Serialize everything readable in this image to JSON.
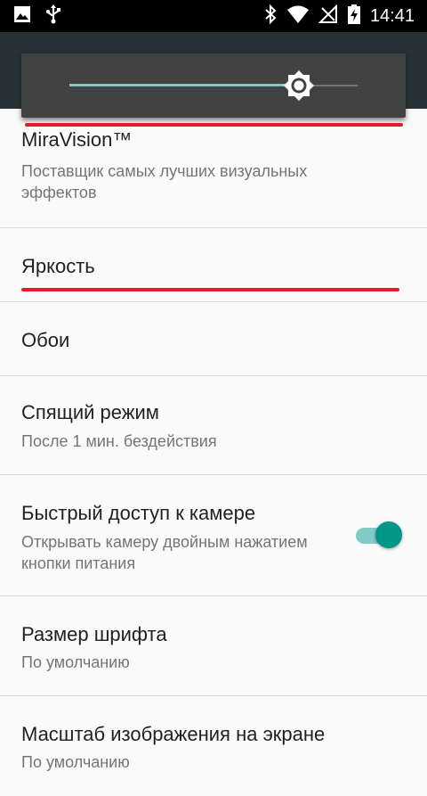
{
  "status_bar": {
    "time": "14:41"
  },
  "brightness": {
    "level": 0.79
  },
  "settings": {
    "items": [
      {
        "title": "MiraVision™",
        "summary": "Поставщик самых лучших визуальных эффектов"
      },
      {
        "title": "Яркость"
      },
      {
        "title": "Обои"
      },
      {
        "title": "Спящий режим",
        "summary": "После 1 мин. бездействия"
      },
      {
        "title": "Быстрый доступ к камере",
        "summary": "Открывать камеру двойным нажатием кнопки питания",
        "toggle_on": true
      },
      {
        "title": "Размер шрифта",
        "summary": "По умолчанию"
      },
      {
        "title": "Масштаб изображения на экране",
        "summary": "По умолчанию"
      }
    ]
  },
  "colors": {
    "accent": "#009688",
    "highlight": "#e21c2c",
    "toolbar": "#263238"
  }
}
